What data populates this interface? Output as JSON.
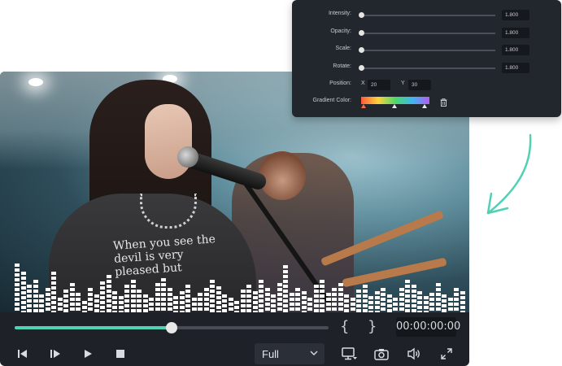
{
  "settings_panel": {
    "sliders": [
      {
        "label": "Intensity:",
        "value": "1.800",
        "level": 0
      },
      {
        "label": "Opacity:",
        "value": "1.800",
        "level": 0
      },
      {
        "label": "Scale:",
        "value": "1.800",
        "level": 0
      },
      {
        "label": "Rotate:",
        "value": "1.800",
        "level": 0
      }
    ],
    "position": {
      "label": "Position:",
      "x_label": "X",
      "x_value": "20",
      "y_label": "Y",
      "y_value": "30"
    },
    "gradient": {
      "label": "Gradient Color:",
      "colors": [
        "#ff5a3a",
        "#ffd23a",
        "#4cd96a",
        "#3fb6f0",
        "#b25cf0"
      ],
      "delete_icon": "trash-icon"
    }
  },
  "video": {
    "shirt_text": "When you see the devil is very pleased but"
  },
  "player": {
    "progress": 0.5,
    "mark_in": "{",
    "mark_out": "}",
    "timecode": "00:00:00:00",
    "buttons": [
      "previous-frame-icon",
      "next-frame-icon",
      "play-icon",
      "stop-icon"
    ],
    "zoom_select": "Full",
    "right_icons": [
      "display-icon",
      "camera-icon",
      "volume-icon",
      "fullscreen-icon"
    ]
  },
  "colors": {
    "accent": "#4fd1b4",
    "panel_bg": "#22272e",
    "player_bg": "#1e2228"
  }
}
